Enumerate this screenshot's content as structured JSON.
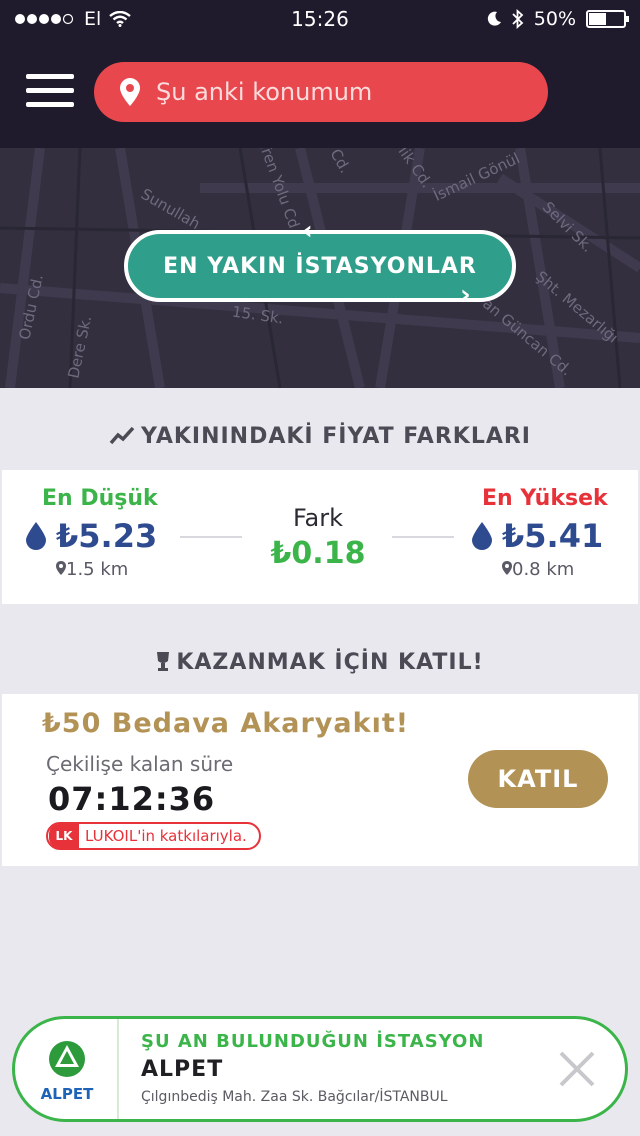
{
  "status_bar": {
    "carrier": "El",
    "time": "15:26",
    "battery": "50%"
  },
  "header": {
    "location_placeholder": "Şu anki konumum"
  },
  "map": {
    "streets": [
      "Tren Yolu Cd.",
      "Sunullah",
      "Ordu Cd.",
      "Dere Sk.",
      "15. Sk.",
      "Cd.",
      "lik Cd.",
      "İsmail Gönül",
      "Selvi Sk.",
      "Şht. Mezarlığı",
      "an Güncan Cd."
    ],
    "nearest_button_label": "EN YAKIN İSTASYONLAR"
  },
  "price_diff": {
    "section_title": "YAKININDAKİ FİYAT FARKLARI",
    "lowest": {
      "label": "En Düşük",
      "price": "₺5.23",
      "distance": "1.5 km"
    },
    "difference": {
      "label": "Fark",
      "value": "₺0.18"
    },
    "highest": {
      "label": "En Yüksek",
      "price": "₺5.41",
      "distance": "0.8 km"
    }
  },
  "promo": {
    "section_title": "KAZANMAK İÇİN KATIL!",
    "title": "₺50 Bedava Akaryakıt!",
    "subtitle": "Çekilişe kalan süre",
    "timer": "07:12:36",
    "sponsor_text": "LUKOIL'in katkılarıyla.",
    "sponsor_logo_text": "LK",
    "join_button": "KATIL"
  },
  "current_station": {
    "heading": "ŞU AN BULUNDUĞUN İSTASYON",
    "name": "ALPET",
    "address": "Çılgınbediş Mah. Zaa Sk. Bağcılar/İSTANBUL",
    "logo_text": "ALPET"
  },
  "colors": {
    "header_bg": "#1f1b2d",
    "location_red": "#e8474d",
    "teal": "#2f9e8a",
    "green": "#3bb54a",
    "red": "#e8323a",
    "blue": "#2f4b8f",
    "gold": "#b39256"
  }
}
